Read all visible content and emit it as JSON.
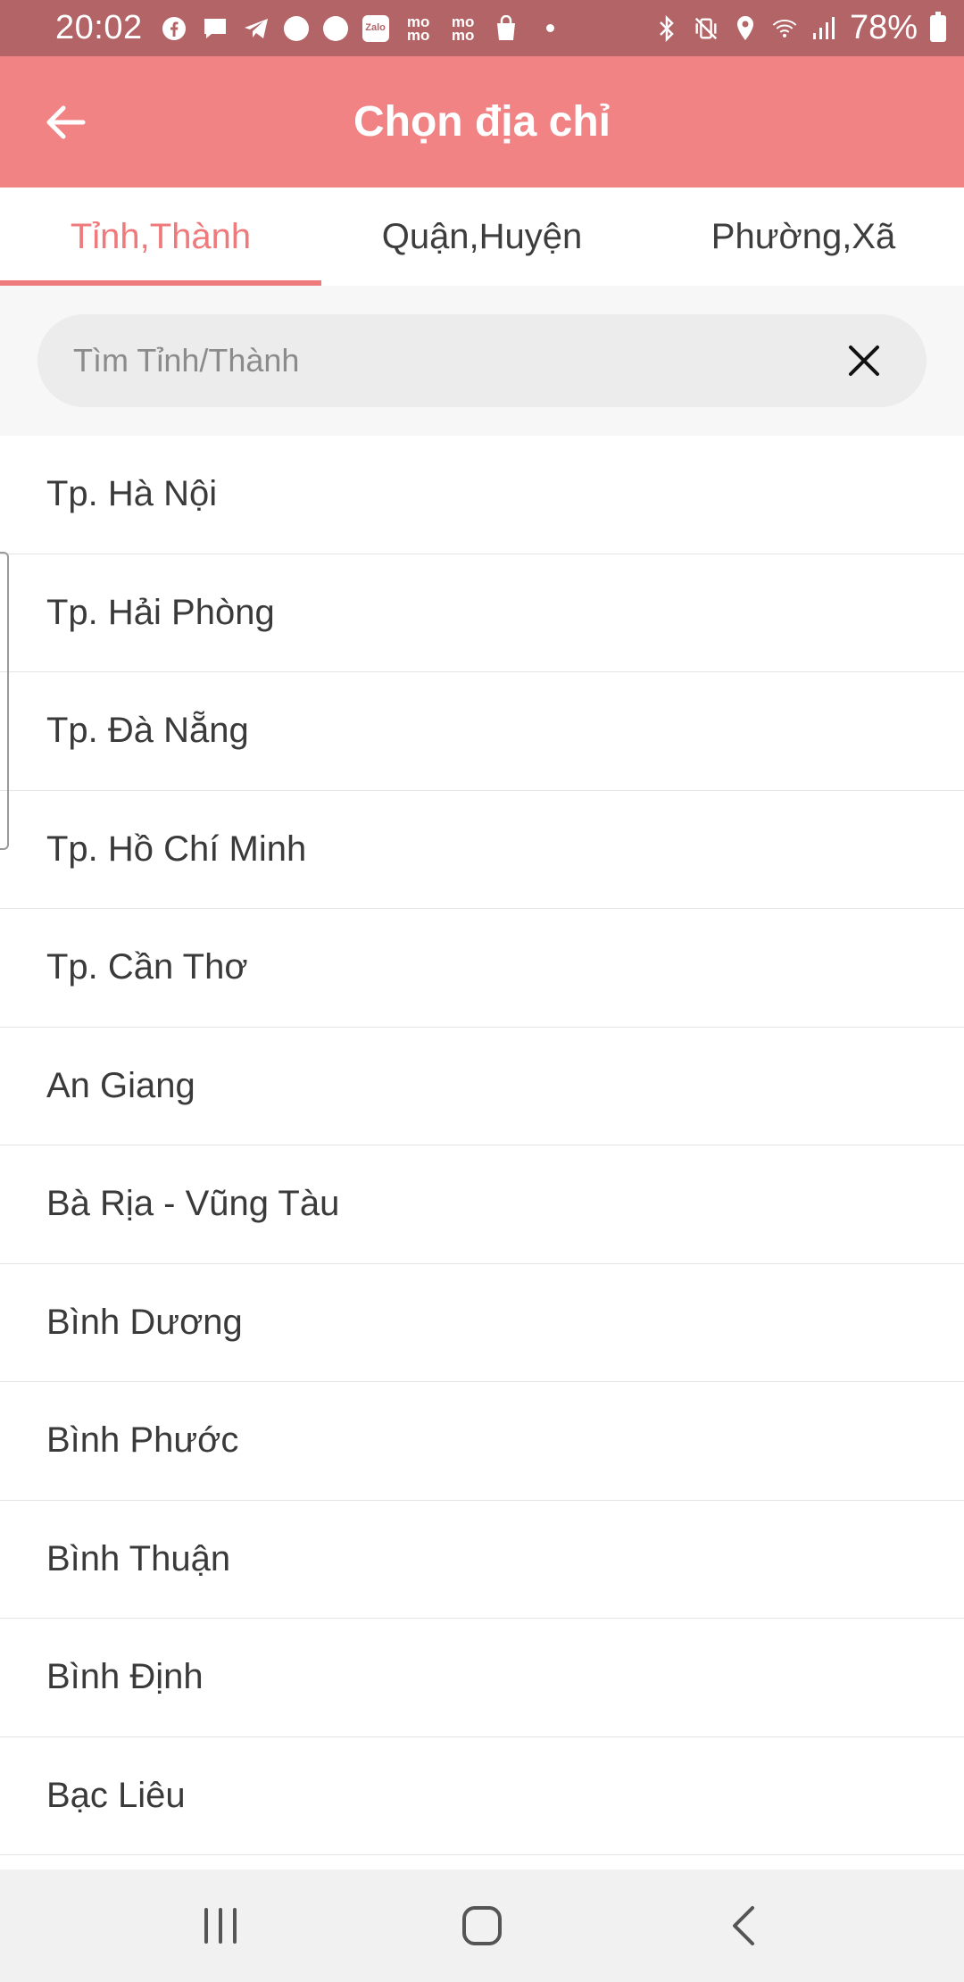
{
  "status_bar": {
    "time": "20:02",
    "battery": "78%",
    "left_icons": [
      "facebook-icon",
      "messenger-icon",
      "telegram-icon",
      "profile-icon",
      "profile-icon",
      "zalo-icon",
      "momo-icon",
      "momo-icon",
      "shopping-bag-icon",
      "dot-icon"
    ],
    "right_icons": [
      "bluetooth-icon",
      "vibrate-icon",
      "location-icon",
      "wifi-icon",
      "signal-icon",
      "battery-icon"
    ],
    "zalo_label": "Zalo",
    "momo_label": "mo mo",
    "background": "#b26467"
  },
  "app_bar": {
    "title": "Chọn địa chỉ",
    "back_icon": "arrow-left-icon",
    "background": "#f18384"
  },
  "tabs": [
    {
      "label": "Tỉnh,Thành",
      "active": true
    },
    {
      "label": "Quận,Huyện",
      "active": false
    },
    {
      "label": "Phường,Xã",
      "active": false
    }
  ],
  "search": {
    "placeholder": "Tìm Tỉnh/Thành",
    "value": "",
    "clear_icon": "close-icon"
  },
  "provinces": [
    "Tp. Hà Nội",
    "Tp. Hải Phòng",
    "Tp. Đà Nẵng",
    "Tp. Hồ Chí Minh",
    "Tp. Cần Thơ",
    "An Giang",
    "Bà Rịa - Vũng Tàu",
    "Bình Dương",
    "Bình Phước",
    "Bình Thuận",
    "Bình Định",
    "Bạc Liêu"
  ],
  "nav_bar": {
    "icons": [
      "recent-apps-icon",
      "home-icon",
      "back-icon"
    ]
  },
  "colors": {
    "accent": "#ee7a7c",
    "text": "#3a3a3a"
  }
}
